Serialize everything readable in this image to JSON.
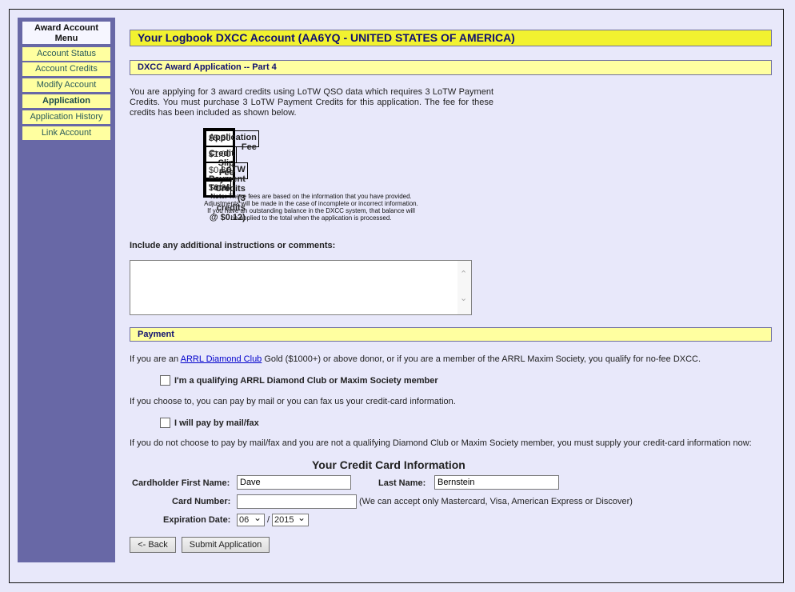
{
  "sidebar": {
    "title": "Award Account Menu",
    "items": [
      {
        "label": "Account Status",
        "active": false
      },
      {
        "label": "Account Credits",
        "active": false
      },
      {
        "label": "Modify Account",
        "active": false
      },
      {
        "label": "Application",
        "active": true
      },
      {
        "label": "Application History",
        "active": false
      },
      {
        "label": "Link Account",
        "active": false
      }
    ]
  },
  "header": {
    "title": "Your Logbook DXCC Account (AA6YQ - UNITED STATES OF AMERICA)",
    "subtitle": "DXCC Award Application -- Part 4"
  },
  "intro": "You are applying for 3 award credits using LoTW QSO data which requires 3 LoTW Payment Credits. You must purchase 3 LoTW Payment Credits for this application. The fee for these credits has been included as shown below.",
  "fees": {
    "rows": [
      {
        "label": "Application Fee",
        "amount": "$5.50"
      },
      {
        "label": "Credit Slip Fee",
        "amount": "$1.00"
      },
      {
        "label": "LoTW Payment Credits (3 credits @ $0.12)",
        "amount": "$0.36"
      }
    ],
    "total_label": "Total",
    "total_amount": "$6.86",
    "note_bold": "Note:",
    "note": " These fees are based on the information that you have provided. Adjustments will be made in the case of incomplete or incorrect information. If you have an outstanding balance in the DXCC system, that balance will be applied to the total when the application is processed."
  },
  "comments": {
    "label": "Include any additional instructions or comments:",
    "value": ""
  },
  "payment": {
    "title": "Payment",
    "diamond_pre": "If you are an ",
    "diamond_link": "ARRL Diamond Club",
    "diamond_post": " Gold ($1000+) or above donor, or if you are a member of the ARRL Maxim Society, you qualify for no-fee DXCC.",
    "checkbox_diamond": {
      "label": "I'm a qualifying ARRL Diamond Club or Maxim Society member",
      "checked": false
    },
    "mail_text": "If you choose to, you can pay by mail or you can fax us your credit-card information.",
    "checkbox_mail": {
      "label": "I will pay by mail/fax",
      "checked": false
    },
    "supply_text": "If you do not choose to pay by mail/fax and you are not a qualifying Diamond Club or Maxim Society member, you must supply your credit-card information now:"
  },
  "credit_card": {
    "title": "Your Credit Card Information",
    "first_name_label": "Cardholder First Name:",
    "first_name": "Dave",
    "last_name_label": "Last Name:",
    "last_name": "Bernstein",
    "card_number_label": "Card Number:",
    "card_number": "",
    "card_note": "(We can accept only Mastercard, Visa, American Express or Discover)",
    "expiration_label": "Expiration Date:",
    "exp_month": "06",
    "exp_separator": "/",
    "exp_year": "2015"
  },
  "buttons": {
    "back": "<- Back",
    "submit": "Submit Application"
  }
}
